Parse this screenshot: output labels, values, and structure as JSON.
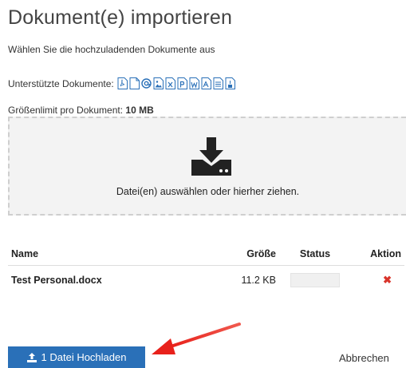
{
  "header": {
    "title": "Dokument(e) importieren",
    "subtitle": "Wählen Sie die hochzuladenden Dokumente aus"
  },
  "supported": {
    "label": "Unterstützte Dokumente:",
    "icons": [
      "pdf-file-icon",
      "blank-file-icon",
      "email-icon",
      "image-file-icon",
      "excel-file-icon",
      "powerpoint-file-icon",
      "word-file-icon",
      "acrobat-file-icon",
      "text-file-icon",
      "odt-file-icon"
    ],
    "icon_color": "#2a70b8"
  },
  "limit": {
    "label": "Größenlimit pro Dokument:",
    "value": "10 MB"
  },
  "dropzone": {
    "icon": "download-tray-icon",
    "text": "Datei(en) auswählen oder hierher ziehen."
  },
  "table": {
    "headers": {
      "name": "Name",
      "size": "Größe",
      "status": "Status",
      "action": "Aktion"
    },
    "rows": [
      {
        "name": "Test Personal.docx",
        "size": "11.2 KB",
        "status": "",
        "action_icon": "remove-x-icon"
      }
    ]
  },
  "footer": {
    "upload_label": "1 Datei Hochladen",
    "upload_icon": "upload-icon",
    "cancel_label": "Abbrechen",
    "accent": "#2a70b8",
    "annotation_color": "#e8211b"
  }
}
